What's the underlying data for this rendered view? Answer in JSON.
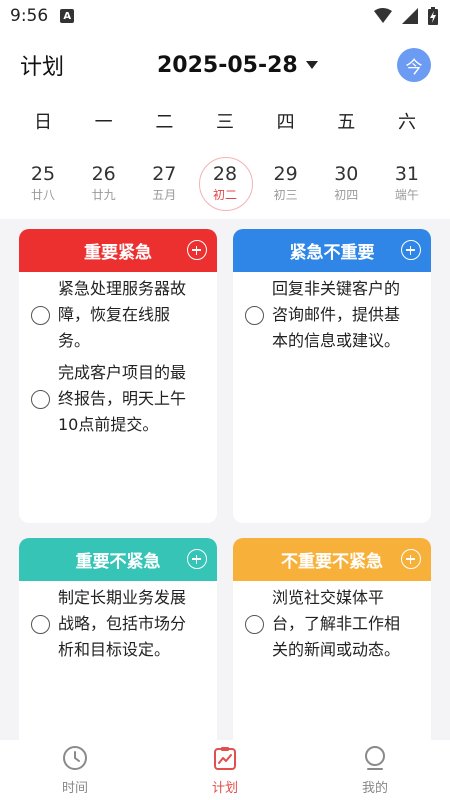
{
  "status": {
    "time": "9:56",
    "notif": "A"
  },
  "header": {
    "title": "计划",
    "date": "2025-05-28",
    "today": "今"
  },
  "weekdays": [
    "日",
    "一",
    "二",
    "三",
    "四",
    "五",
    "六"
  ],
  "dates": [
    {
      "num": "25",
      "lunar": "廿八"
    },
    {
      "num": "26",
      "lunar": "廿九"
    },
    {
      "num": "27",
      "lunar": "五月"
    },
    {
      "num": "28",
      "lunar": "初二"
    },
    {
      "num": "29",
      "lunar": "初三"
    },
    {
      "num": "30",
      "lunar": "初四"
    },
    {
      "num": "31",
      "lunar": "端午"
    }
  ],
  "selected_index": 3,
  "quadrants": [
    {
      "title": "重要紧急",
      "color": "#ec2f2f",
      "tasks": [
        "紧急处理服务器故障，恢复在线服务。",
        "完成客户项目的最终报告，明天上午10点前提交。"
      ]
    },
    {
      "title": "紧急不重要",
      "color": "#2f86e6",
      "tasks": [
        "回复非关键客户的咨询邮件，提供基本的信息或建议。"
      ]
    },
    {
      "title": "重要不紧急",
      "color": "#36c4b6",
      "tasks": [
        "制定长期业务发展战略，包括市场分析和目标设定。"
      ]
    },
    {
      "title": "不重要不紧急",
      "color": "#f7b13a",
      "tasks": [
        "浏览社交媒体平台，了解非工作相关的新闻或动态。"
      ]
    }
  ],
  "nav": [
    {
      "label": "时间",
      "icon": "clock-icon"
    },
    {
      "label": "计划",
      "icon": "chart-icon"
    },
    {
      "label": "我的",
      "icon": "profile-icon"
    }
  ],
  "colors": {
    "accent": "#e2504b",
    "today_button": "#6b9bf2"
  }
}
